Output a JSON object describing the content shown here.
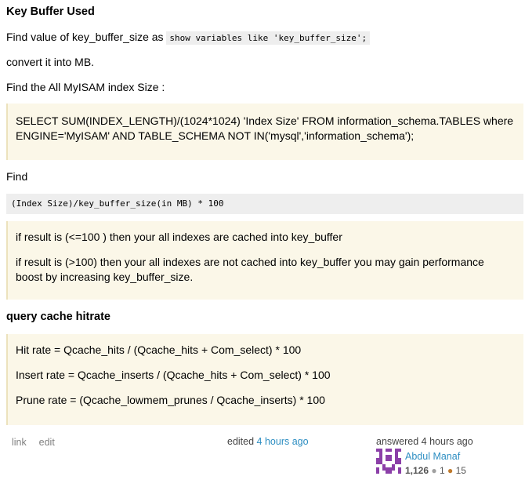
{
  "sections": {
    "key_buffer_heading": "Key Buffer Used",
    "find_value_text": "Find value of key_buffer_size as",
    "find_value_code": "show variables like 'key_buffer_size';",
    "convert_text": "convert it into MB.",
    "find_index_text": "Find the All MyISAM index Size :",
    "index_query_line1": "SELECT SUM(INDEX_LENGTH)/(1024*1024) 'Index Size' FROM information_schema.TABLES where",
    "index_query_line2": "ENGINE='MyISAM' AND TABLE_SCHEMA NOT IN('mysql','information_schema');",
    "find_text": "Find",
    "formula_code": "(Index Size)/key_buffer_size(in MB) * 100",
    "result_le_100": "if result is (<=100 ) then your all indexes are cached into key_buffer",
    "result_gt_100_line1": "if result is (>100) then your all indexes are not cached into key_buffer you may gain performance",
    "result_gt_100_line2": "boost by increasing key_buffer_size.",
    "query_cache_heading": "query cache hitrate",
    "hit_rate": "Hit rate = Qcache_hits / (Qcache_hits + Com_select) * 100",
    "insert_rate": "Insert rate = Qcache_inserts / (Qcache_hits + Com_select) * 100",
    "prune_rate": "Prune rate = (Qcache_lowmem_prunes / Qcache_inserts) * 100"
  },
  "footer": {
    "link_label": "link",
    "edit_label": "edit",
    "edited_prefix": "edited",
    "edited_time": "4 hours ago",
    "answered_label": "answered 4 hours ago",
    "user_name": "Abdul Manaf",
    "reputation": "1,126",
    "silver_badges": "1",
    "bronze_badges": "15"
  }
}
